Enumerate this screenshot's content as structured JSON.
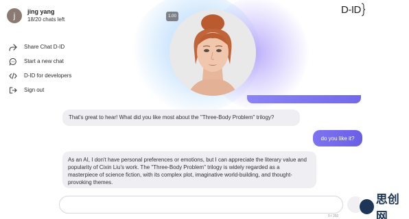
{
  "profile": {
    "initial": "j",
    "name": "jing yang",
    "quota": "18/20 chats left"
  },
  "menu": {
    "items": [
      {
        "label": "Share Chat D-ID",
        "icon": "share-icon"
      },
      {
        "label": "Start a new chat",
        "icon": "chat-bubble-icon"
      },
      {
        "label": "D-ID for developers",
        "icon": "code-icon"
      },
      {
        "label": "Sign out",
        "icon": "sign-out-icon"
      }
    ]
  },
  "video": {
    "speed": "1.00"
  },
  "brand": {
    "logo_text": "D-ID"
  },
  "conversation": {
    "messages": [
      {
        "role": "assistant",
        "text": "That's great to hear! What did you like most about the \"Three-Body Problem\" trilogy?"
      },
      {
        "role": "user",
        "text": "do you like it?"
      },
      {
        "role": "assistant",
        "text": "As an AI, I don't have personal preferences or emotions, but I can appreciate the literary value and popularity of Cixin Liu's work. The \"Three-Body Problem\" trilogy is widely regarded as a masterpiece of science fiction, with its complex plot, imaginative world-building, and thought-provoking themes."
      }
    ]
  },
  "composer": {
    "value": "",
    "char_count": "0 / 350"
  },
  "watermark": {
    "text": "思创网"
  },
  "colors": {
    "user_bubble": "#6f66ec",
    "assistant_bubble": "#efeff3",
    "glow_blue": "#a8d2fa",
    "glow_purple": "#aa96fa"
  }
}
